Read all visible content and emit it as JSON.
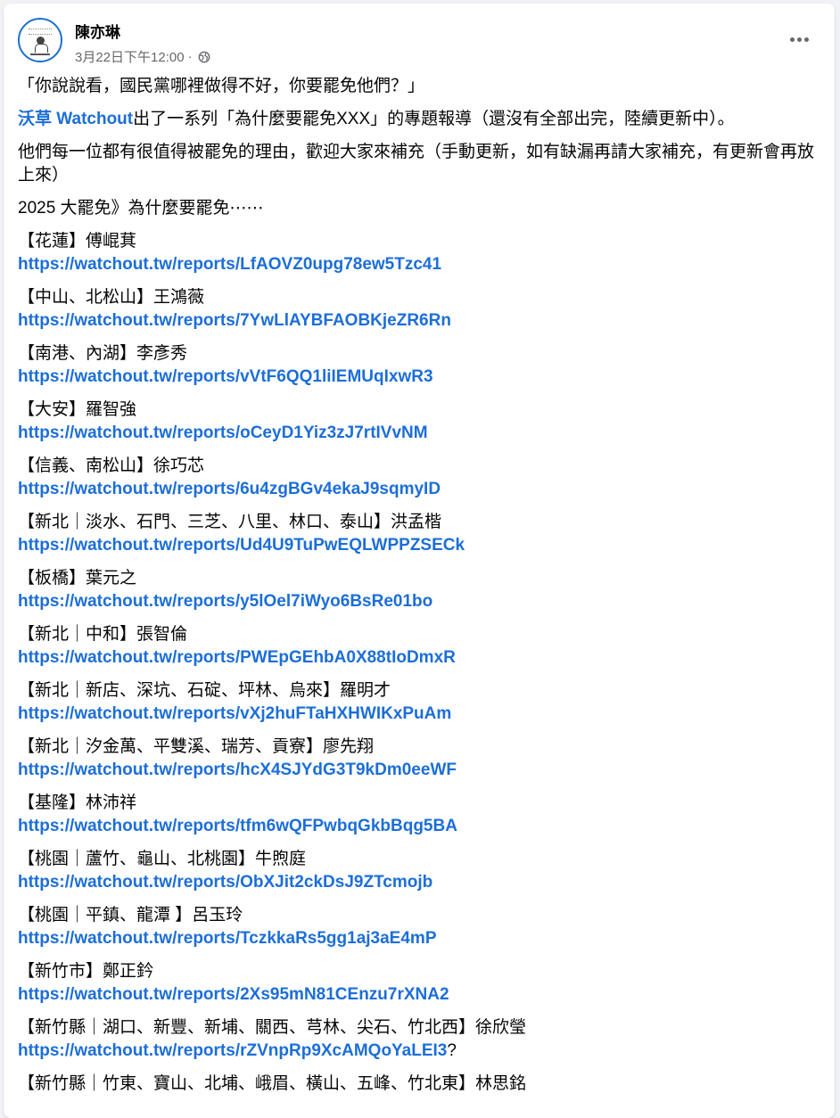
{
  "post": {
    "author": "陳亦琳",
    "timestamp": "3月22日下午12:00",
    "separator": "·",
    "privacy_icon": "globe-icon",
    "more_icon": "more-options-icon",
    "intro": "「你說說看，國民黨哪裡做得不好，你要罷免他們？」",
    "page_link": "沃草 Watchout",
    "line2_rest": "出了一系列「為什麼要罷免XXX」的專題報導（還沒有全部出完，陸續更新中）。",
    "line3": "他們每一位都有很值得被罷免的理由，歡迎大家來補充（手動更新，如有缺漏再請大家補充，有更新會再放上來）",
    "line4": "2025 大罷免》為什麼要罷免⋯⋯",
    "entries": [
      {
        "label": "【花蓮】傅崐萁",
        "url": "https://watchout.tw/reports/LfAOVZ0upg78ew5Tzc41",
        "suffix": ""
      },
      {
        "label": "【中山、北松山】王鴻薇",
        "url": "https://watchout.tw/reports/7YwLlAYBFAOBKjeZR6Rn",
        "suffix": ""
      },
      {
        "label": "【南港、內湖】李彥秀",
        "url": "https://watchout.tw/reports/vVtF6QQ1liIEMUqIxwR3",
        "suffix": ""
      },
      {
        "label": "【大安】羅智強",
        "url": "https://watchout.tw/reports/oCeyD1Yiz3zJ7rtIVvNM",
        "suffix": ""
      },
      {
        "label": "【信義、南松山】徐巧芯",
        "url": "https://watchout.tw/reports/6u4zgBGv4ekaJ9sqmyID",
        "suffix": ""
      },
      {
        "label": "【新北｜淡水、石門、三芝、八里、林口、泰山】洪孟楷",
        "url": "https://watchout.tw/reports/Ud4U9TuPwEQLWPPZSECk",
        "suffix": ""
      },
      {
        "label": "【板橋】葉元之",
        "url": "https://watchout.tw/reports/y5lOel7iWyo6BsRe01bo",
        "suffix": ""
      },
      {
        "label": "【新北｜中和】張智倫",
        "url": "https://watchout.tw/reports/PWEpGEhbA0X88tIoDmxR",
        "suffix": ""
      },
      {
        "label": "【新北｜新店、深坑、石碇、坪林、烏來】羅明才",
        "url": "https://watchout.tw/reports/vXj2huFTaHXHWIKxPuAm",
        "suffix": ""
      },
      {
        "label": "【新北｜汐金萬、平雙溪、瑞芳、貢寮】廖先翔",
        "url": "https://watchout.tw/reports/hcX4SJYdG3T9kDm0eeWF",
        "suffix": ""
      },
      {
        "label": "【基隆】林沛祥",
        "url": "https://watchout.tw/reports/tfm6wQFPwbqGkbBqg5BA",
        "suffix": ""
      },
      {
        "label": "【桃園｜蘆竹、龜山、北桃園】牛煦庭",
        "url": "https://watchout.tw/reports/ObXJit2ckDsJ9ZTcmojb",
        "suffix": ""
      },
      {
        "label": "【桃園｜平鎮、龍潭 】呂玉玲",
        "url": "https://watchout.tw/reports/TczkkaRs5gg1aj3aE4mP",
        "suffix": ""
      },
      {
        "label": "【新竹市】鄭正鈐",
        "url": "https://watchout.tw/reports/2Xs95mN81CEnzu7rXNA2",
        "suffix": ""
      },
      {
        "label": "【新竹縣｜湖口、新豐、新埔、關西、芎林、尖石、竹北西】徐欣瑩",
        "url": "https://watchout.tw/reports/rZVnpRp9XcAMQoYaLEI3",
        "suffix": "?"
      },
      {
        "label": "【新竹縣｜竹東、寶山、北埔、峨眉、橫山、五峰、竹北東】林思銘",
        "url": "",
        "suffix": ""
      }
    ]
  },
  "colors": {
    "link": "#1c6ed8",
    "meta": "#65676b",
    "text": "#050505"
  }
}
